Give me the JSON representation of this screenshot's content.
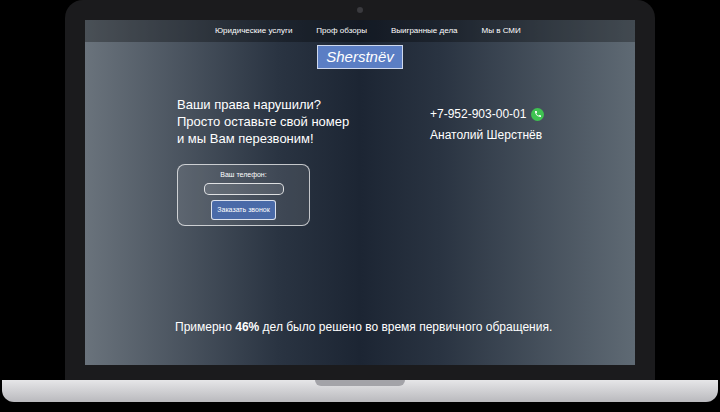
{
  "nav": {
    "items": [
      {
        "label": "Юридические услуги"
      },
      {
        "label": "Проф обзоры"
      },
      {
        "label": "Выигранные дела"
      },
      {
        "label": "Мы в СМИ"
      }
    ]
  },
  "logo": {
    "text": "Sherstnëv"
  },
  "headline": {
    "lines": [
      "Ваши права нарушили?",
      "Просто оставьте свой номер",
      "и мы Вам перезвоним!"
    ]
  },
  "contact": {
    "phone": "+7-952-903-00-01",
    "name": "Анатолий Шерстнёв"
  },
  "form": {
    "label": "Ваш телефон:",
    "button": "Заказать звонок"
  },
  "stat": {
    "prefix": "Примерно ",
    "value": "46%",
    "suffix": " дел было решено во время первичного обращения."
  }
}
